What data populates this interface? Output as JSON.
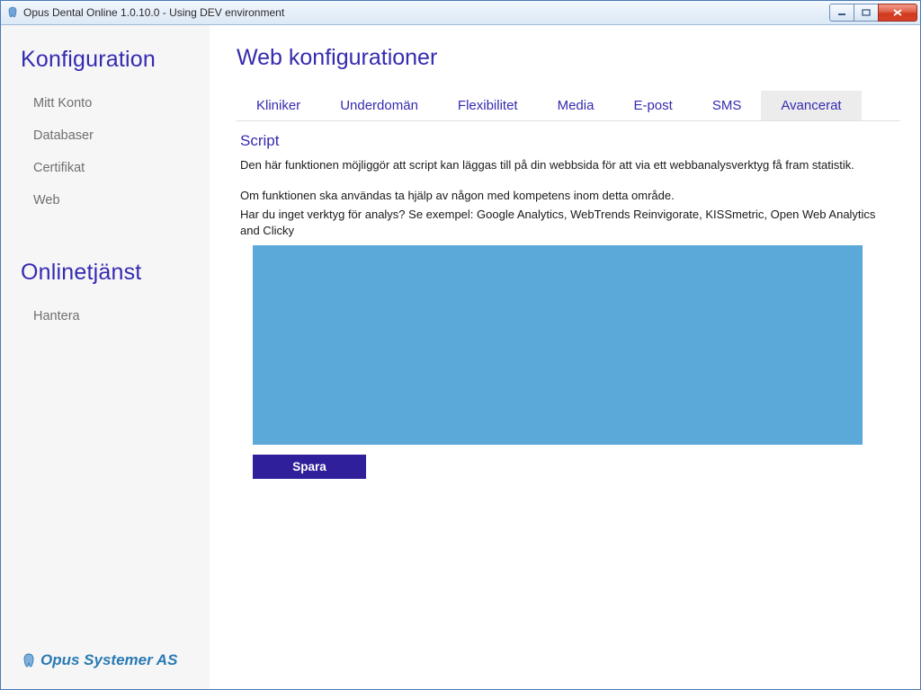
{
  "window": {
    "title": "Opus Dental Online 1.0.10.0 - Using DEV environment"
  },
  "sidebar": {
    "sections": [
      {
        "title": "Konfiguration",
        "items": [
          "Mitt Konto",
          "Databaser",
          "Certifikat",
          "Web"
        ]
      },
      {
        "title": "Onlinetjänst",
        "items": [
          "Hantera"
        ]
      }
    ],
    "brand": "Opus Systemer AS"
  },
  "main": {
    "title": "Web konfigurationer",
    "tabs": [
      "Kliniker",
      "Underdomän",
      "Flexibilitet",
      "Media",
      "E-post",
      "SMS",
      "Avancerat"
    ],
    "active_tab_index": 6,
    "panel": {
      "heading": "Script",
      "p1": "Den här funktionen möjliggör att script kan läggas till på din webbsida för att via ett webbanalysverktyg få fram statistik.",
      "p2": "Om funktionen ska användas ta hjälp av någon med kompetens inom detta område.",
      "p3": "Har du inget verktyg för analys? Se exempel: Google Analytics, WebTrends Reinvigorate, KISSmetric, Open Web Analytics and Clicky",
      "script_value": "",
      "save_label": "Spara"
    }
  }
}
